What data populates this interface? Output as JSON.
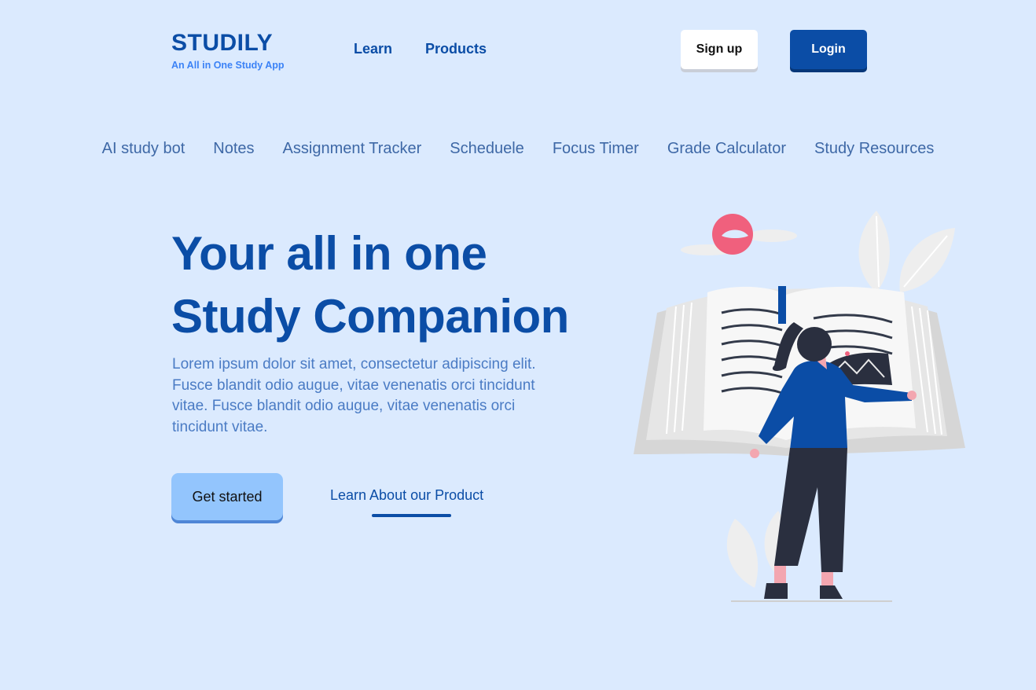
{
  "brand": {
    "name": "STUDILY",
    "tagline": "An All in One Study App"
  },
  "nav": {
    "items": [
      "Learn",
      "Products"
    ]
  },
  "auth": {
    "signup_label": "Sign up",
    "login_label": "Login"
  },
  "features": {
    "items": [
      "AI study bot",
      "Notes",
      "Assignment Tracker",
      "Scheduele",
      "Focus Timer",
      "Grade Calculator",
      "Study Resources"
    ]
  },
  "hero": {
    "title_line1": "Your all in one",
    "title_line2": "Study Companion",
    "description": "Lorem ipsum dolor sit amet, consectetur adipiscing elit. Fusce blandit odio augue, vitae venenatis orci tincidunt vitae. Fusce blandit odio augue, vitae venenatis orci tincidunt vitae.",
    "cta_label": "Get started",
    "secondary_label": "Learn About our Product"
  },
  "colors": {
    "background": "#dbeafe",
    "primary": "#0b4da6",
    "accent_light": "#93c5fd",
    "sun": "#f0607d"
  },
  "illustration": {
    "icon": "woman-reading-giant-book-icon"
  }
}
